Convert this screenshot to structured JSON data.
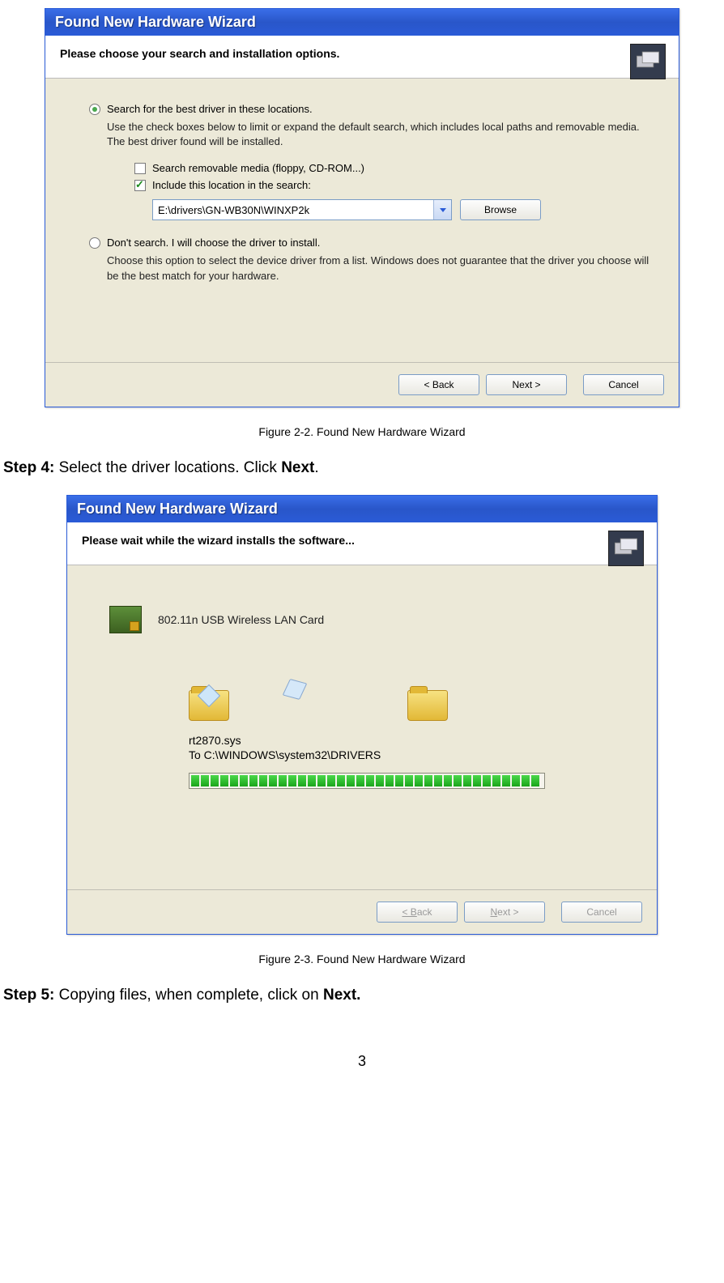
{
  "dialog1": {
    "title": "Found New Hardware Wizard",
    "header": "Please choose your search and installation options.",
    "radio1": "Search for the best driver in these locations.",
    "radio1_desc": "Use the check boxes below to limit or expand the default search, which includes local paths and removable media. The best driver found will be installed.",
    "check1": "Search removable media (floppy, CD-ROM...)",
    "check2": "Include this location in the search:",
    "path": "E:\\drivers\\GN-WB30N\\WINXP2k",
    "browse": "Browse",
    "radio2": "Don't search. I will choose the driver to install.",
    "radio2_desc": "Choose this option to select the device driver from a list.  Windows does not guarantee that the driver you choose will be the best match for your hardware.",
    "back": "< Back",
    "next": "Next >",
    "cancel": "Cancel"
  },
  "caption1": "Figure 2-2. Found New Hardware Wizard",
  "step4": {
    "label": "Step 4:",
    "text": " Select the driver locations. Click ",
    "bold": "Next",
    "end": "."
  },
  "dialog2": {
    "title": "Found New Hardware Wizard",
    "header": "Please wait while the wizard installs the software...",
    "device": "802.11n USB Wireless LAN Card",
    "file": "rt2870.sys",
    "dest": "To C:\\WINDOWS\\system32\\DRIVERS",
    "back": "< Back",
    "next": "Next >",
    "cancel": "Cancel"
  },
  "caption2": "Figure 2-3. Found New Hardware Wizard",
  "step5": {
    "label": "Step 5:",
    "text": " Copying files, when complete, click on ",
    "bold": "Next.",
    "end": ""
  },
  "page_number": "3"
}
